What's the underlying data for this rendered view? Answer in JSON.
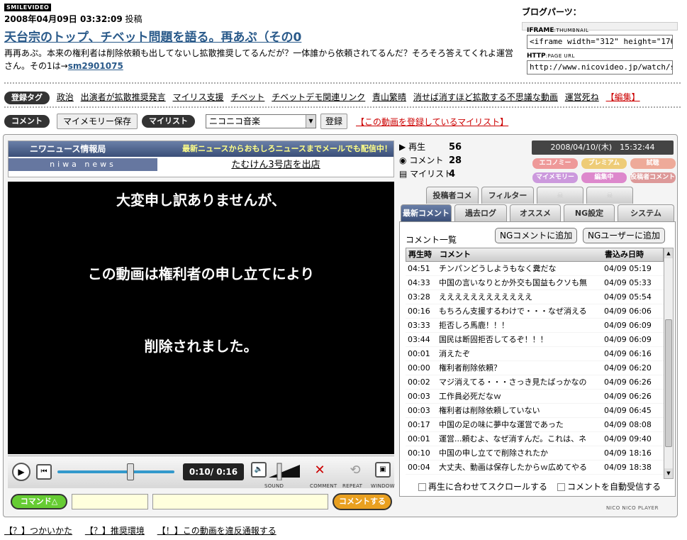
{
  "header": {
    "logo": "SMILEVIDEO",
    "post_date": "2008年04月09日 03:32:09",
    "post_suffix": "投稿",
    "title": "天台宗のトップ、チベット問題を語る。再あぷ（その0",
    "description": "再再あぷ。本来の権利者は削除依頼も出してないし拡散推奨してるんだが？一体誰から依頼されてるんだ？そろそろ答えてくれよ運営さん。その1は→",
    "sm_link": "sm2901075"
  },
  "blog": {
    "heading": "ブログパーツ：",
    "iframe_label": "IFRAME",
    "iframe_sub": ":THUMBNAIL",
    "iframe_value": "<iframe width=\"312\" height=\"176",
    "http_label": "HTTP",
    "http_sub": ":PAGE URL",
    "http_value": "http://www.nicovideo.jp/watch/sm"
  },
  "tags": {
    "label": "登録タグ",
    "items": [
      "政治",
      "出演者が拡散推奨発言",
      "マイリス支援",
      "チベット",
      "チベットデモ関連リンク",
      "青山繁晴",
      "消せば消すほど拡散する不思議な動画",
      "運営死ね"
    ],
    "edit": "【編集】"
  },
  "controls_row": {
    "comment_label": "コメント",
    "memory_button": "マイメモリー保存",
    "mylist_label": "マイリスト",
    "mylist_select": "ニコニコ音楽",
    "register_button": "登録",
    "mylist_link": "【この動画を登録しているマイリスト】"
  },
  "ad": {
    "line1": "ニワニュース情報局",
    "line1_right": "最新ニュースからおもしろニュースまでメールでも配信中！",
    "line2": "niwa news",
    "headline": "たむけん3号店を出店"
  },
  "video": {
    "line1": "大変申し訳ありませんが、",
    "line2": "この動画は権利者の申し立てにより",
    "line3": "削除されました。"
  },
  "player": {
    "time": "0:10/ 0:16",
    "progress": 0.625,
    "sound_label": "SOUND",
    "comment_label": "COMMENT",
    "repeat_label": "REPEAT",
    "window_label": "WINDOW",
    "command_button": "コマンド△",
    "send_button": "コメントする"
  },
  "stats": {
    "play_label": "再生",
    "play_count": "56",
    "comment_label": "コメント",
    "comment_count": "28",
    "mylist_label": "マイリスト",
    "mylist_count": "4",
    "clock": "2008/04/10/(木)　15:32:44",
    "chips": [
      "エコノミー",
      "プレミアム",
      "試聴",
      "マイメモリー",
      "編集中",
      "投稿者コメント"
    ]
  },
  "tabs": {
    "top": [
      "投稿者コメ",
      "フィルター"
    ],
    "bottom": [
      "最新コメント",
      "過去ログ",
      "オススメ",
      "NG設定",
      "システム"
    ]
  },
  "comments": {
    "title": "コメント一覧",
    "ng_comment": "NGコメントに追加",
    "ng_user": "NGユーザーに追加",
    "col_time": "再生時",
    "col_comment": "コメント",
    "col_date": "書込み日時",
    "rows": [
      {
        "t": "04:51",
        "c": "チンパンどうしようもなく糞だな",
        "d": "04/09 05:19"
      },
      {
        "t": "04:33",
        "c": "中国の言いなりとか外交も国益もクソも無",
        "d": "04/09 05:33"
      },
      {
        "t": "03:28",
        "c": "ええええええええええええ",
        "d": "04/09 05:54"
      },
      {
        "t": "00:16",
        "c": "もちろん支援するわけで・・・なぜ消える",
        "d": "04/09 06:06"
      },
      {
        "t": "03:33",
        "c": "拒否しろ馬鹿！！！",
        "d": "04/09 06:09"
      },
      {
        "t": "03:44",
        "c": "国民は断固拒否してるぞ！！！",
        "d": "04/09 06:09"
      },
      {
        "t": "00:01",
        "c": "消えたぞ",
        "d": "04/09 06:16"
      },
      {
        "t": "00:00",
        "c": "権利者削除依頼？",
        "d": "04/09 06:20"
      },
      {
        "t": "00:02",
        "c": "マジ消えてる・・・さっき見たばっかなの",
        "d": "04/09 06:26"
      },
      {
        "t": "00:03",
        "c": "工作員必死だなｗ",
        "d": "04/09 06:26"
      },
      {
        "t": "00:03",
        "c": "権利者は削除依頼していない",
        "d": "04/09 06:45"
      },
      {
        "t": "00:17",
        "c": "中国の足の味に夢中な運営であった",
        "d": "04/09 08:08"
      },
      {
        "t": "00:01",
        "c": "運営...頼むよ、なぜ消すんだ。これは、ネ",
        "d": "04/09 09:40"
      },
      {
        "t": "00:10",
        "c": "中国の申し立てで削除されたか",
        "d": "04/09 18:16"
      },
      {
        "t": "00:04",
        "c": "大丈夫、動画は保存したからｗ広めてやる",
        "d": "04/09 18:38"
      }
    ],
    "scroll_sync": "再生に合わせてスクロールする",
    "auto_receive": "コメントを自動受信する",
    "player_name": "NICO NICO PLAYER"
  },
  "footer": {
    "links": [
      "【？】つかいかた",
      "【？】推奨環境",
      "【！】この動画を違反通報する"
    ]
  }
}
